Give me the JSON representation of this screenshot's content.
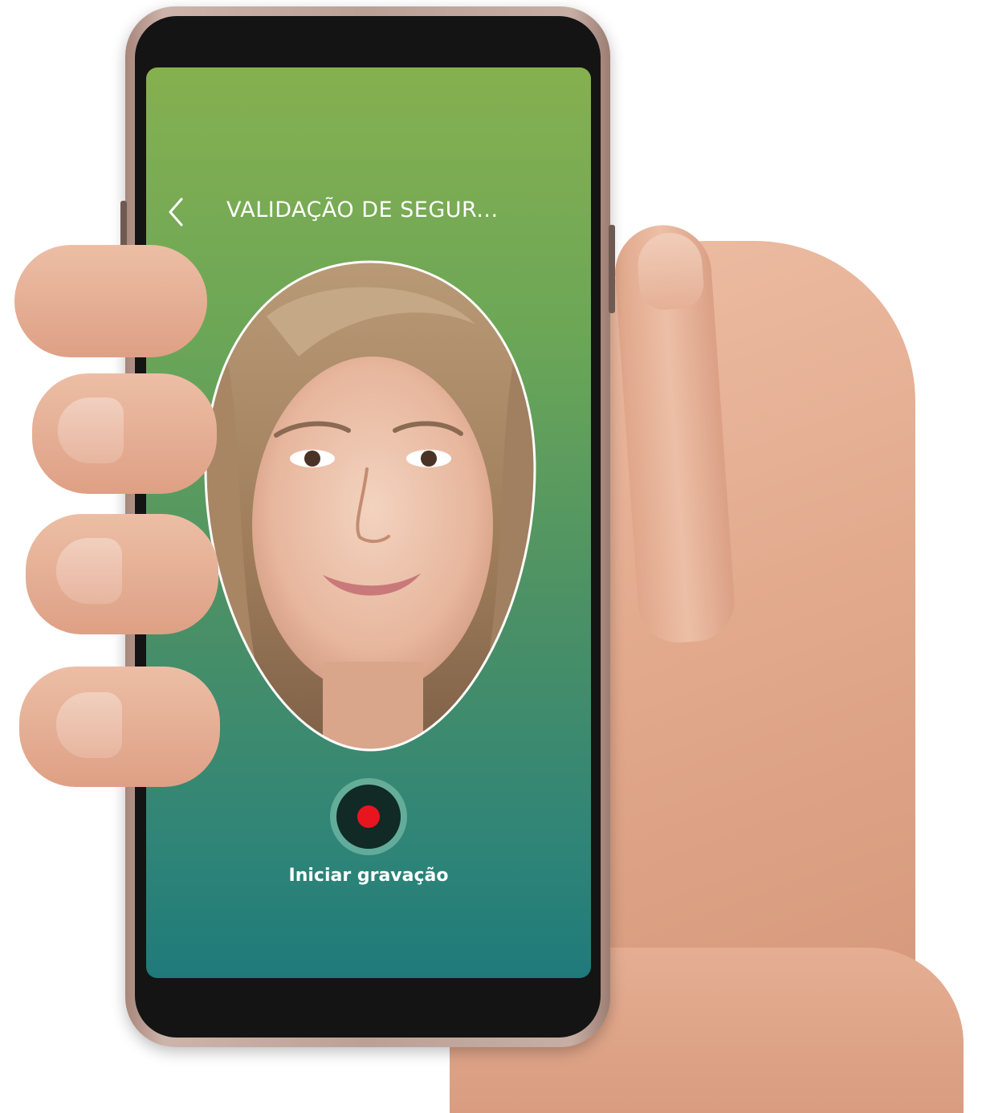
{
  "header": {
    "title": "VALIDAÇÃO DE SEGUR..."
  },
  "recording": {
    "label": "Iniciar gravação"
  },
  "icons": {
    "back": "chevron-left-icon",
    "record": "record-dot-icon"
  },
  "colors": {
    "screen_gradient_top": "#86b050",
    "screen_gradient_bottom": "#1f7a7a",
    "record_dot": "#e8151f",
    "text": "#ffffff"
  }
}
